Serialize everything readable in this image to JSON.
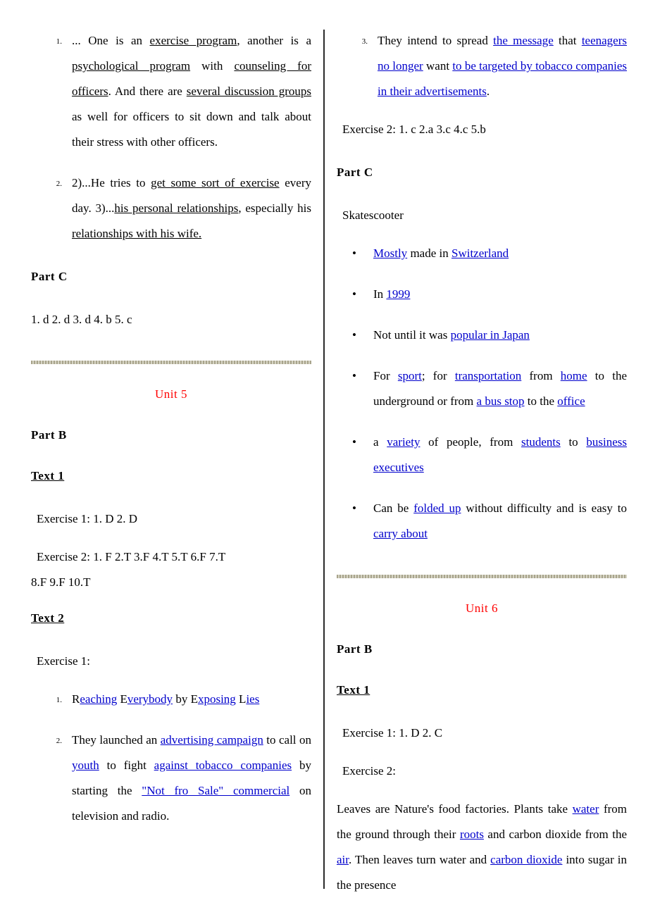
{
  "document": {
    "title": "Answer Key",
    "accent_red": "#ff0000",
    "link_blue": "#0000cc",
    "rule_color": "#b3b09a"
  },
  "left_column": {
    "unit4_part_b_items": [
      {
        "marker": "1.",
        "segments": [
          {
            "text": "... One is an ",
            "style": "plain"
          },
          {
            "text": "exercise program",
            "style": "underline"
          },
          {
            "text": ", another is a ",
            "style": "plain"
          },
          {
            "text": "psychological program",
            "style": "underline"
          },
          {
            "text": " with ",
            "style": "plain"
          },
          {
            "text": "counseling for officers",
            "style": "underline"
          },
          {
            "text": ". And there are ",
            "style": "plain"
          },
          {
            "text": "several discussion groups",
            "style": "underline"
          },
          {
            "text": " as well for officers to sit down and talk about their stress with other officers.",
            "style": "plain"
          }
        ]
      },
      {
        "marker": "2.",
        "segments": [
          {
            "text": "2)...He tries to ",
            "style": "plain"
          },
          {
            "text": "get some sort of exercise",
            "style": "underline"
          },
          {
            "text": " every day. 3)...",
            "style": "plain"
          },
          {
            "text": "his personal relationships",
            "style": "underline"
          },
          {
            "text": ", especially his ",
            "style": "plain"
          },
          {
            "text": "relationships with his wife.",
            "style": "underline"
          }
        ]
      }
    ],
    "unit4_part_c_heading": "Part C",
    "unit4_part_c_answers": "1. d  2. d  3. d  4. b  5. c",
    "unit5_heading": "Unit 5",
    "unit5_part_b_heading": "Part B",
    "unit5_text1_heading": "Text 1",
    "unit5_text1_exercise1": "Exercise 1: 1. D     2. D",
    "unit5_text1_exercise2_line1": "Exercise 2: 1. F  2.T  3.F  4.T  5.T  6.F  7.T",
    "unit5_text1_exercise2_line2": "8.F  9.F  10.T",
    "unit5_text2_heading": "Text 2",
    "unit5_text2_exercise1_label": "Exercise 1:",
    "unit5_text2_items": [
      {
        "marker": "1.",
        "segments": [
          {
            "text": "R",
            "style": "plain"
          },
          {
            "text": "eaching",
            "style": "link"
          },
          {
            "text": " E",
            "style": "plain"
          },
          {
            "text": "verybody",
            "style": "link"
          },
          {
            "text": " by ",
            "style": "plain"
          },
          {
            "text": "E",
            "style": "plain"
          },
          {
            "text": "xposing",
            "style": "link"
          },
          {
            "text": " L",
            "style": "plain"
          },
          {
            "text": "ies",
            "style": "link"
          }
        ]
      },
      {
        "marker": "2.",
        "segments": [
          {
            "text": "They launched an ",
            "style": "plain"
          },
          {
            "text": "advertising campaign",
            "style": "link"
          },
          {
            "text": " to call on ",
            "style": "plain"
          },
          {
            "text": "youth",
            "style": "link"
          },
          {
            "text": " to fight ",
            "style": "plain"
          },
          {
            "text": "against tobacco companies",
            "style": "link"
          },
          {
            "text": " by starting the ",
            "style": "plain"
          },
          {
            "text": "\"Not fro Sale\" commercial",
            "style": "link"
          },
          {
            "text": " on television and radio.",
            "style": "plain"
          }
        ]
      }
    ]
  },
  "right_column": {
    "unit5_text2_item3": {
      "marker": "3.",
      "segments": [
        {
          "text": "They intend to spread ",
          "style": "plain"
        },
        {
          "text": "the message",
          "style": "link"
        },
        {
          "text": " that ",
          "style": "plain"
        },
        {
          "text": "teenagers no longer",
          "style": "link"
        },
        {
          "text": " want ",
          "style": "plain"
        },
        {
          "text": "to be targeted by tobacco companies in their advertisements",
          "style": "link"
        },
        {
          "text": ".",
          "style": "plain"
        }
      ]
    },
    "unit5_text2_exercise2": "Exercise 2: 1. c  2.a  3.c  4.c  5.b",
    "unit5_part_c_heading": "Part C",
    "unit5_part_c_subject": "Skatescooter",
    "unit5_part_c_bullets": [
      {
        "segments": [
          {
            "text": "Mostly",
            "style": "link"
          },
          {
            "text": " made in ",
            "style": "plain"
          },
          {
            "text": "Switzerland",
            "style": "link"
          }
        ]
      },
      {
        "segments": [
          {
            "text": "In ",
            "style": "plain"
          },
          {
            "text": "1999",
            "style": "link"
          }
        ]
      },
      {
        "segments": [
          {
            "text": "Not until it was ",
            "style": "plain"
          },
          {
            "text": "popular in Japan",
            "style": "link"
          }
        ]
      },
      {
        "segments": [
          {
            "text": "For ",
            "style": "plain"
          },
          {
            "text": "sport",
            "style": "link"
          },
          {
            "text": "; for ",
            "style": "plain"
          },
          {
            "text": "transportation",
            "style": "link"
          },
          {
            "text": " from ",
            "style": "plain"
          },
          {
            "text": "home",
            "style": "link"
          },
          {
            "text": " to the underground or from ",
            "style": "plain"
          },
          {
            "text": "a bus stop",
            "style": "link"
          },
          {
            "text": " to the ",
            "style": "plain"
          },
          {
            "text": "office",
            "style": "link"
          }
        ]
      },
      {
        "segments": [
          {
            "text": "a ",
            "style": "plain"
          },
          {
            "text": "variety",
            "style": "link"
          },
          {
            "text": " of people, from ",
            "style": "plain"
          },
          {
            "text": "students",
            "style": "link"
          },
          {
            "text": " to ",
            "style": "plain"
          },
          {
            "text": "business executives",
            "style": "link"
          }
        ]
      },
      {
        "segments": [
          {
            "text": "Can be ",
            "style": "plain"
          },
          {
            "text": "folded up",
            "style": "link"
          },
          {
            "text": " without difficulty and is easy to ",
            "style": "plain"
          },
          {
            "text": "carry about",
            "style": "link"
          }
        ]
      }
    ],
    "unit6_heading": "Unit 6",
    "unit6_part_b_heading": "Part B",
    "unit6_text1_heading": "Text 1",
    "unit6_text1_exercise1": "Exercise 1: 1. D     2. C",
    "unit6_text1_exercise2_label": "Exercise 2:",
    "unit6_text1_exercise2_paragraph": [
      {
        "text": "Leaves are Nature's food factories. Plants take ",
        "style": "plain"
      },
      {
        "text": "water",
        "style": "link"
      },
      {
        "text": " from the ground through their ",
        "style": "plain"
      },
      {
        "text": "roots",
        "style": "link"
      },
      {
        "text": " and carbon dioxide from the ",
        "style": "plain"
      },
      {
        "text": "air",
        "style": "link"
      },
      {
        "text": ". Then leaves turn water and ",
        "style": "plain"
      },
      {
        "text": "carbon dioxide",
        "style": "link"
      },
      {
        "text": " into sugar in the presence",
        "style": "plain"
      }
    ]
  }
}
